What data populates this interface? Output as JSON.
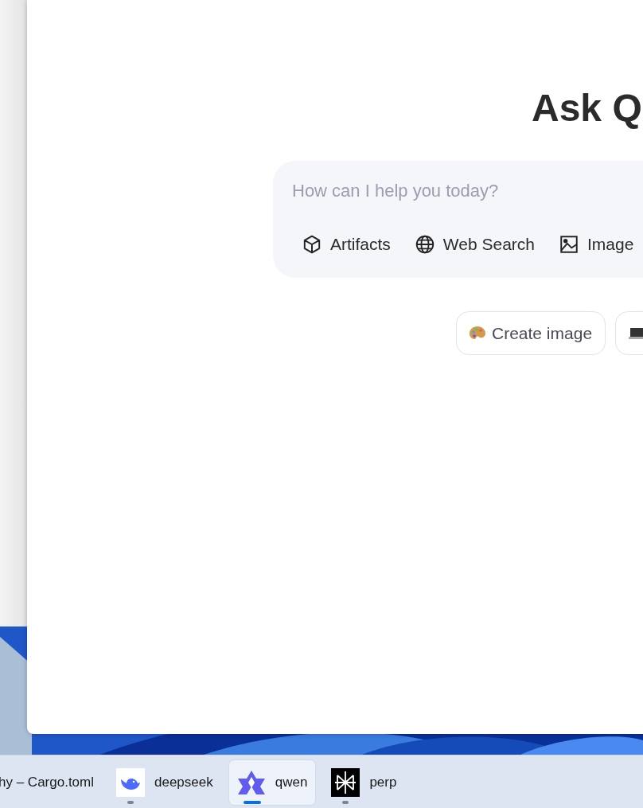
{
  "window": {
    "heading": "Ask Q",
    "input": {
      "placeholder": "How can I help you today?"
    },
    "tools": [
      {
        "label": "Artifacts"
      },
      {
        "label": "Web Search"
      },
      {
        "label": "Image"
      }
    ],
    "suggestions": [
      {
        "label": "Create image"
      }
    ]
  },
  "taskbar": {
    "items": [
      {
        "label": "hy – Cargo.toml",
        "selected": false,
        "running": false
      },
      {
        "label": "deepseek",
        "selected": false,
        "running": true
      },
      {
        "label": "qwen",
        "selected": true,
        "running": true
      },
      {
        "label": "perp",
        "selected": false,
        "running": true
      }
    ]
  }
}
